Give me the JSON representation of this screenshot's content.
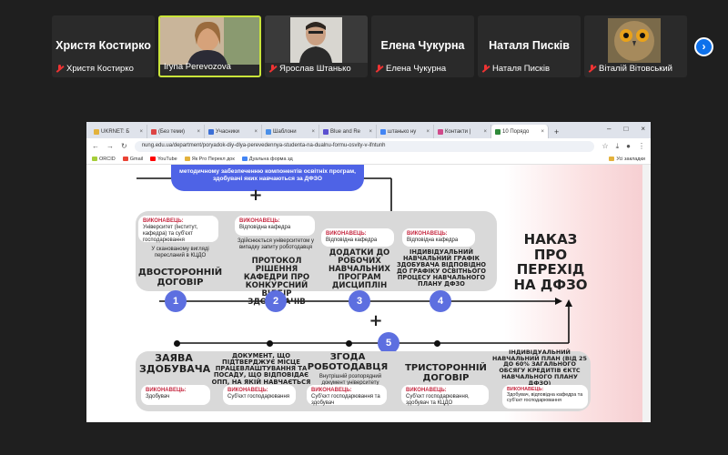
{
  "participants": [
    {
      "big_name": "Христя Костирко",
      "label": "Христя Костирко",
      "muted": true,
      "video": false
    },
    {
      "big_name": "",
      "label": "Iryna Perevozova",
      "muted": false,
      "video": true
    },
    {
      "big_name": "",
      "label": "Ярослав Штанько",
      "muted": true,
      "video": true
    },
    {
      "big_name": "Елена Чукурна",
      "label": "Елена Чукурна",
      "muted": true,
      "video": false
    },
    {
      "big_name": "Наталя Писків",
      "label": "Наталя Писків",
      "muted": true,
      "video": false
    },
    {
      "big_name": "",
      "label": "Віталій Вітовський",
      "muted": true,
      "video": true
    }
  ],
  "browser": {
    "tabs": [
      "UKRNET: Б",
      "(Без теми)",
      "Учасники",
      "Шаблони",
      "Blue and Re",
      "штанько ну",
      "Контакти |",
      "10 Порядо"
    ],
    "url": "nung.edu.ua/department/poryadok-diy-dlya-perevedennya-studenta-na-dualnu-formu-osvity-v-ifntunh",
    "bookmarks": [
      "ORCID",
      "Gmail",
      "YouTube",
      "Як Pro Перекл док",
      "Дуальна форма зд"
    ],
    "bookmarks_right": "Усі закладки"
  },
  "graphic": {
    "top_text": "методичному забезпеченню компонентів освітніх програм, здобувачі яких навчаються за ДФЗО",
    "plus": "+",
    "exec_heading": "ВИКОНАВЕЦЬ:",
    "steps_top": [
      {
        "exec": "Університет (Інститут, кафедра) та суб'єкт господарювання",
        "note": "У сканованому вигляді пересланий в КЦДО",
        "title": "ДВОСТОРОННІЙ ДОГОВІР",
        "num": "1"
      },
      {
        "exec": "Відповідна кафедра",
        "note": "Здійснюється університетом у випадку запиту роботодавця",
        "title": "ПРОТОКОЛ РІШЕННЯ КАФЕДРИ ПРО КОНКУРСНИЙ ВІДБІР ЗДОБУВАЧІВ",
        "num": "2"
      },
      {
        "exec": "Відповідна кафедра",
        "note": "",
        "title": "ДОДАТКИ ДО РОБОЧИХ НАВЧАЛЬНИХ ПРОГРАМ ДИСЦИПЛІН",
        "num": "3"
      },
      {
        "exec": "Відповідна кафедра",
        "note": "",
        "title": "ІНДИВІДУАЛЬНИЙ НАВЧАЛЬНИЙ ГРАФІК ЗДОБУВАЧА ВІДПОВІДНО ДО ГРАФІКУ ОСВІТНЬОГО ПРОЦЕСУ НАВЧАЛЬНОГО ПЛАНУ ДФЗО",
        "num": "4"
      }
    ],
    "result_title": "НАКАЗ ПРО ПЕРЕХІД НА ДФЗО",
    "step5_num": "5",
    "steps_bottom": [
      {
        "title": "ЗАЯВА ЗДОБУВАЧА",
        "exec": "Здобувач"
      },
      {
        "title": "ДОКУМЕНТ, ЩО ПІДТВЕРДЖУЄ МІСЦЕ ПРАЦЕВЛАШТУВАННЯ ТА ПОСАДУ, ЩО ВІДПОВІДАЄ ОПП, НА ЯКІЙ НАВЧАЄТЬСЯ ЗДОБУВАЧ",
        "exec": "Суб'єкт господарювання"
      },
      {
        "title": "ЗГОДА РОБОТОДАВЦЯ",
        "note": "Внутрішній розпорядний документ університету",
        "exec": "Суб'єкт господарювання та здобувач"
      },
      {
        "title": "ТРИСТОРОННІЙ ДОГОВІР",
        "exec": "Суб'єкт господарювання, здобувач та КЦДО"
      },
      {
        "title": "ІНДИВІДУАЛЬНИЙ НАВЧАЛЬНИЙ ПЛАН (ВІД 25 ДО 60% ЗАГАЛЬНОГО ОБСЯГУ КРЕДИТІВ ЄКТС НАВЧАЛЬНОГО ПЛАНУ ДФЗО)",
        "exec": "Здобувач, відповідна кафедра та суб'єкт господарювання"
      }
    ]
  },
  "colors": {
    "accent_circle": "#5d6fe0",
    "exec_heading": "#c62840",
    "pink_bg": "#f6cdd0"
  }
}
